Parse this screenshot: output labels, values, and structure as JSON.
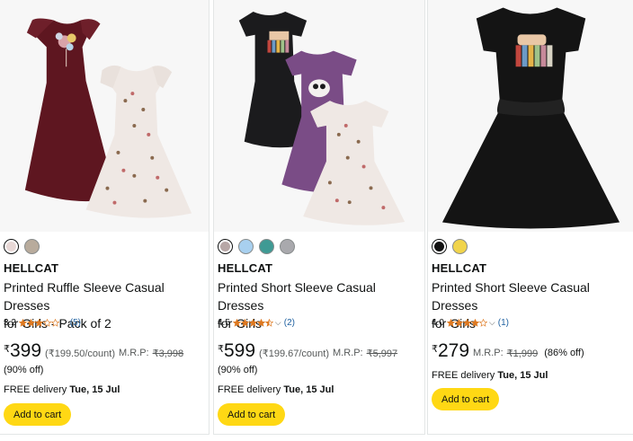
{
  "products": [
    {
      "brand": "HELLCAT",
      "title_line1": "Printed Ruffle Sleeve Casual Dresses",
      "title_line2": "for Girls - Pack of 2",
      "rating": "3.2",
      "rating_value": 3.2,
      "review_count": "(5)",
      "currency": "₹",
      "price": "399",
      "per_unit": "(₹199.50/count)",
      "mrp_label": "M.R.P:",
      "mrp": "₹3,998",
      "discount": "(90% off)",
      "delivery_prefix": "FREE delivery",
      "delivery_date": "Tue, 15 Jul",
      "cta": "Add to cart",
      "swatches": [
        "#e8d8d6",
        "#b8ab9c"
      ],
      "selected_swatch": 0
    },
    {
      "brand": "HELLCAT",
      "title_line1": "Printed Short Sleeve Casual Dresses",
      "title_line2": "for Girls",
      "rating": "4.5",
      "rating_value": 4.5,
      "review_count": "(2)",
      "currency": "₹",
      "price": "599",
      "per_unit": "(₹199.67/count)",
      "mrp_label": "M.R.P:",
      "mrp": "₹5,997",
      "discount": "(90% off)",
      "delivery_prefix": "FREE delivery",
      "delivery_date": "Tue, 15 Jul",
      "cta": "Add to cart",
      "swatches": [
        "#b7a7a6",
        "#a8d0ef",
        "#3f9a94",
        "#a9a9ad"
      ],
      "selected_swatch": 0
    },
    {
      "brand": "HELLCAT",
      "title_line1": "Printed Short Sleeve Casual Dresses",
      "title_line2": "for Girls",
      "rating": "4.0",
      "rating_value": 4.0,
      "review_count": "(1)",
      "currency": "₹",
      "price": "279",
      "mrp_label": "M.R.P:",
      "mrp": "₹1,999",
      "discount": "(86% off)",
      "delivery_prefix": "FREE delivery",
      "delivery_date": "Tue, 15 Jul",
      "cta": "Add to cart",
      "swatches": [
        "#111111",
        "#f1d44b"
      ],
      "selected_swatch": 0
    }
  ],
  "colors": {
    "star": "#de7921",
    "link": "#2162a1",
    "button": "#ffd814"
  }
}
